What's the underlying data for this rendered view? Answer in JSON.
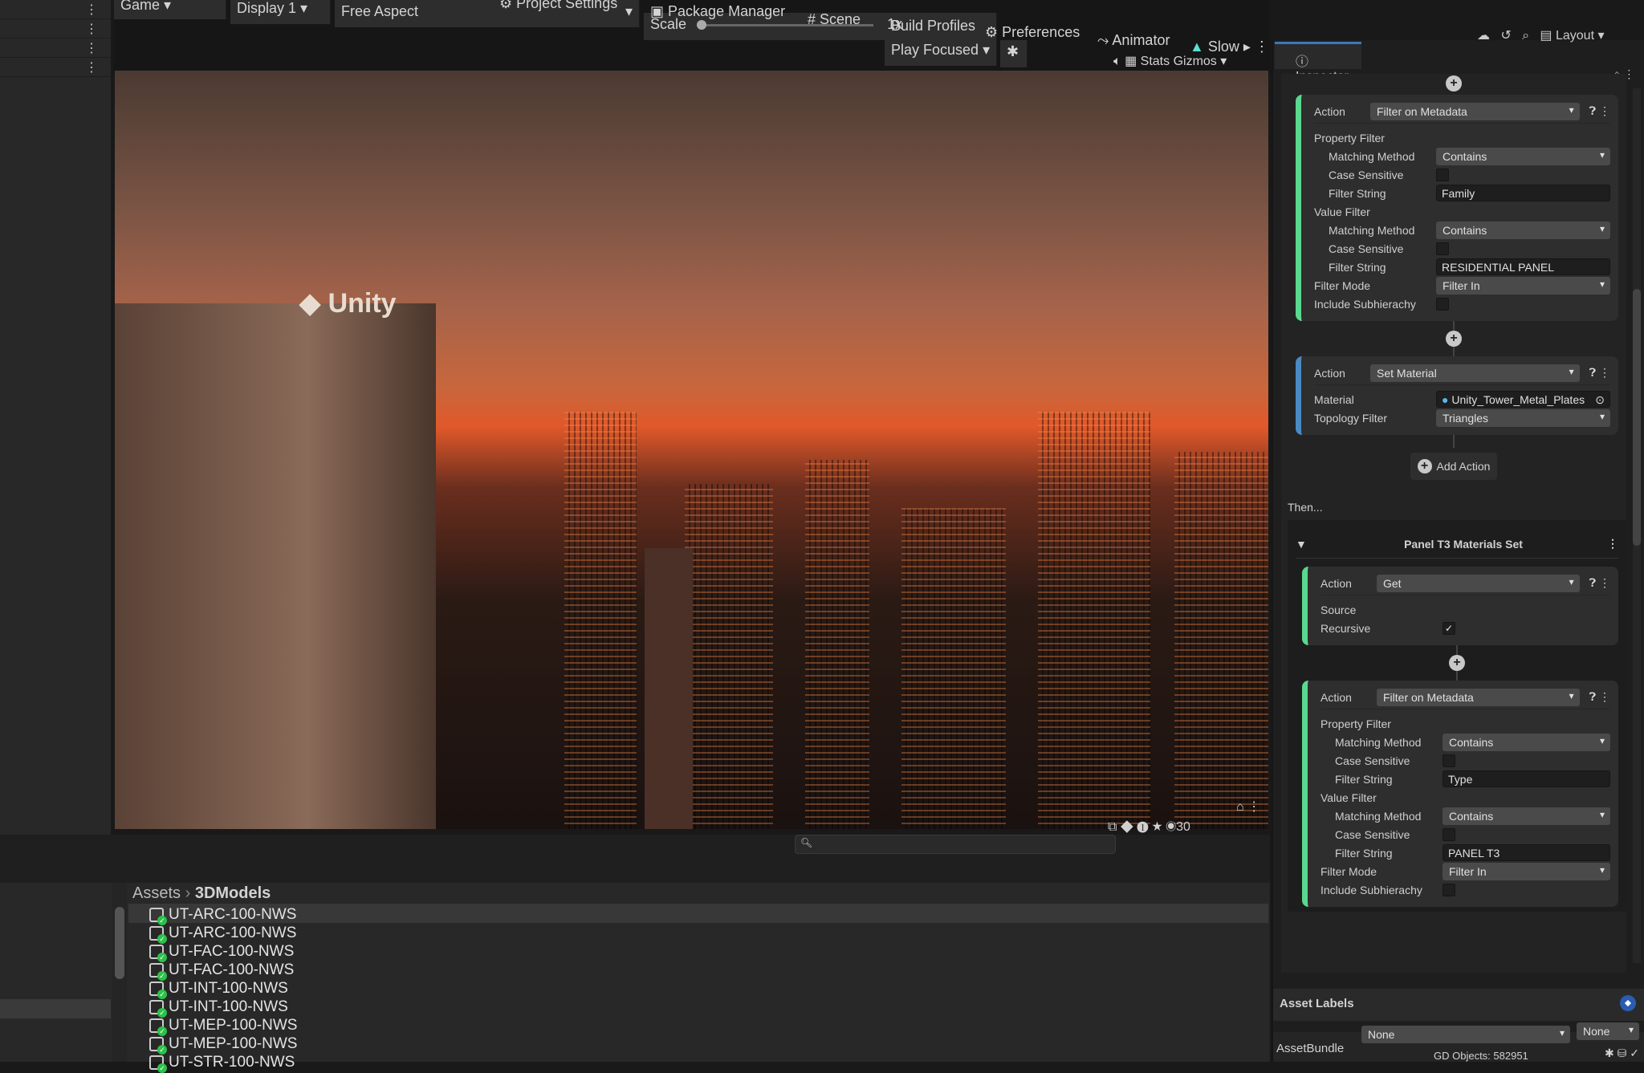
{
  "toolbar": {
    "game_tab": "Game",
    "display": "Display 1",
    "aspect": "Free Aspect",
    "scale_label": "Scale",
    "scale_value": "1x",
    "scale_fraction": 0.0,
    "project_settings": "Project Settings",
    "package_manager": "Package Manager",
    "scene": "Scene",
    "build_profiles": "Build Profiles",
    "preferences": "Preferences",
    "animator": "Animator",
    "slow": "Slow",
    "play_mode": "Play Focused",
    "stats": "Stats",
    "gizmos": "Gizmos",
    "layout": "Layout"
  },
  "game_view": {
    "logo_text": "Unity"
  },
  "project": {
    "breadcrumb": [
      "Assets",
      "3DModels"
    ],
    "visible_count": "30",
    "assets": [
      "UT-ARC-100-NWS",
      "UT-ARC-100-NWS",
      "UT-FAC-100-NWS",
      "UT-FAC-100-NWS",
      "UT-INT-100-NWS",
      "UT-INT-100-NWS",
      "UT-MEP-100-NWS",
      "UT-MEP-100-NWS",
      "UT-STR-100-NWS"
    ]
  },
  "inspector": {
    "tab": "Inspector",
    "action_label": "Action",
    "card1": {
      "action": "Filter on Metadata",
      "property_filter": "Property Filter",
      "matching_method_label": "Matching Method",
      "case_sensitive_label": "Case Sensitive",
      "filter_string_label": "Filter String",
      "value_filter": "Value Filter",
      "filter_mode_label": "Filter Mode",
      "include_subhierarchy_label": "Include Subhierachy",
      "prop_method": "Contains",
      "prop_string": "Family",
      "val_method": "Contains",
      "val_string": "RESIDENTIAL PANEL",
      "filter_mode": "Filter In"
    },
    "card2": {
      "action": "Set Material",
      "material_label": "Material",
      "material": "Unity_Tower_Metal_Plates",
      "topology_label": "Topology Filter",
      "topology": "Triangles"
    },
    "add_action": "Add Action",
    "then": "Then...",
    "group_title": "Panel T3 Materials Set",
    "card3": {
      "action": "Get",
      "source_label": "Source",
      "recursive_label": "Recursive",
      "recursive": true
    },
    "card4": {
      "action": "Filter on Metadata",
      "prop_method": "Contains",
      "prop_string": "Type",
      "val_method": "Contains",
      "val_string": "PANEL T3",
      "filter_mode": "Filter In"
    },
    "asset_labels": "Asset Labels",
    "assetbundle_label": "AssetBundle",
    "assetbundle": "None",
    "variant": "None",
    "status": "GD Objects: 582951"
  }
}
